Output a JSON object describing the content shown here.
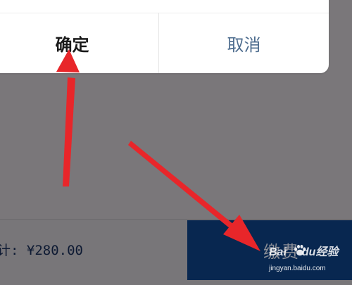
{
  "dialog": {
    "confirm_label": "确定",
    "cancel_label": "取消"
  },
  "footer": {
    "total_label": "计: ",
    "total_amount": "¥280.00",
    "pay_label": "缴费"
  },
  "watermark": {
    "logo_left": "Bai",
    "logo_right": "du经验",
    "url": "jingyan.baidu.com"
  },
  "colors": {
    "overlay": "#7a777a",
    "pay_button": "#082750",
    "arrow": "#e8262a",
    "cancel_text": "#4d6c8e"
  }
}
